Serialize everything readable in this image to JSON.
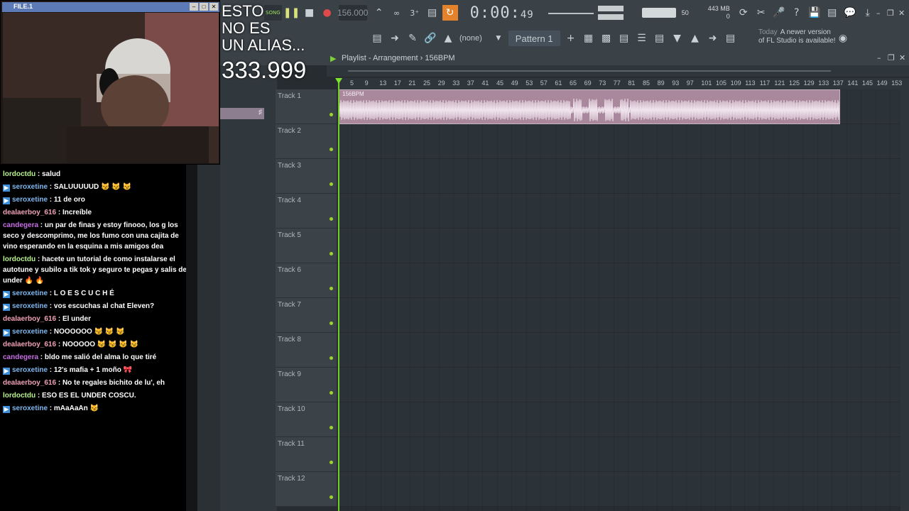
{
  "toolbar": {
    "song_mode": "SONG",
    "tempo": "156.000",
    "time": "0:00",
    "time_small": "49",
    "time_unit": "M:S:CS",
    "cpu_ram": "443 MB",
    "cpu_poly": "0",
    "volume_value": "50",
    "none_label": "(none)",
    "pattern_label": "Pattern 1",
    "news_when": "Today",
    "news_text": "A newer version of FL Studio is available!"
  },
  "playlist": {
    "title": "Playlist - Arrangement › 156BPM",
    "ruler_ticks": [
      "5",
      "9",
      "13",
      "17",
      "21",
      "25",
      "29",
      "33",
      "37",
      "41",
      "45",
      "49",
      "53",
      "57",
      "61",
      "65",
      "69",
      "73",
      "77",
      "81",
      "85",
      "89",
      "93",
      "97",
      "101",
      "105",
      "109",
      "113",
      "117",
      "121",
      "125",
      "129",
      "133",
      "137",
      "141",
      "145",
      "149",
      "153"
    ],
    "tracks": [
      "Track 1",
      "Track 2",
      "Track 3",
      "Track 4",
      "Track 5",
      "Track 6",
      "Track 7",
      "Track 8",
      "Track 9",
      "Track 10",
      "Track 11",
      "Track 12"
    ],
    "clip_label": "156BPM",
    "accent": "#79d23a",
    "clip_color": "#a9879d"
  },
  "webcam": {
    "title": "FILE.1"
  },
  "overlay": {
    "line1": "ESTO",
    "line2": "NO ES",
    "line3": "UN ALIAS...",
    "count": "333.999"
  },
  "chat": {
    "messages": [
      {
        "user": "lordoctdu",
        "color": "#b8f08c",
        "badge": false,
        "text": ": salud"
      },
      {
        "user": "seroxetine",
        "color": "#7fb8ef",
        "badge": true,
        "text": ": SALUUUUUD 😼 😼 😼"
      },
      {
        "user": "seroxetine",
        "color": "#7fb8ef",
        "badge": true,
        "text": ": 11 de oro"
      },
      {
        "user": "dealaerboy_616",
        "color": "#f0a1b6",
        "badge": false,
        "text": ": Increíble"
      },
      {
        "user": "candegera",
        "color": "#c66ee4",
        "badge": false,
        "text": ": un par de finas y estoy finooo, los g los seco y descomprimo, me los fumo con una cajita de vino esperando en la esquina a mis amigos dea"
      },
      {
        "user": "lordoctdu",
        "color": "#b8f08c",
        "badge": false,
        "text": ": hacete un tutorial de como instalarse el autotune y subilo a tik tok y seguro te pegas y salis del under 🔥 🔥"
      },
      {
        "user": "seroxetine",
        "color": "#7fb8ef",
        "badge": true,
        "text": ": L O E S C U C H É"
      },
      {
        "user": "seroxetine",
        "color": "#7fb8ef",
        "badge": true,
        "text": ": vos escuchas al chat Eleven?"
      },
      {
        "user": "dealaerboy_616",
        "color": "#f0a1b6",
        "badge": false,
        "text": ": El under"
      },
      {
        "user": "seroxetine",
        "color": "#7fb8ef",
        "badge": true,
        "text": ": NOOOOOO 😼 😼 😼"
      },
      {
        "user": "dealaerboy_616",
        "color": "#f0a1b6",
        "badge": false,
        "text": ": NOOOOO 😼 😼 😼 😼"
      },
      {
        "user": "candegera",
        "color": "#c66ee4",
        "badge": false,
        "text": ": bldo me salió del alma lo que tiré"
      },
      {
        "user": "seroxetine",
        "color": "#7fb8ef",
        "badge": true,
        "text": ": 12's mafia + 1 moño 🎀"
      },
      {
        "user": "dealaerboy_616",
        "color": "#f0a1b6",
        "badge": false,
        "text": ": No te regales bichito de lu', eh"
      },
      {
        "user": "lordoctdu",
        "color": "#b8f08c",
        "badge": false,
        "text": ": ESO ES EL UNDER COSCU."
      },
      {
        "user": "seroxetine",
        "color": "#7fb8ef",
        "badge": true,
        "text": ": mAaAaAn 😼"
      }
    ]
  }
}
